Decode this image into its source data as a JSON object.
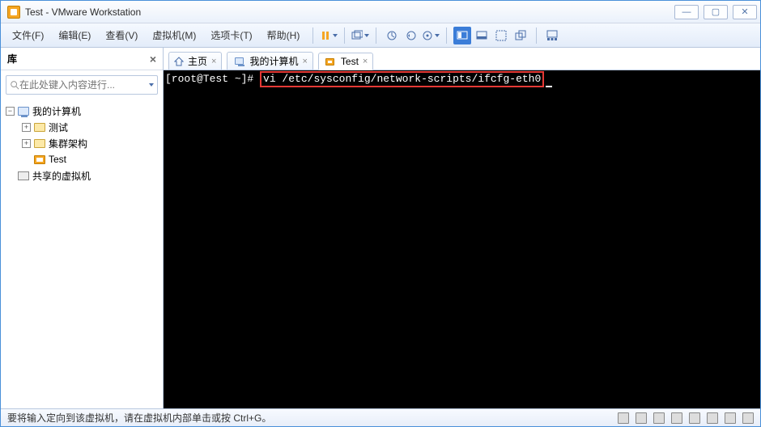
{
  "title": "Test - VMware Workstation",
  "menu": [
    "文件(F)",
    "编辑(E)",
    "查看(V)",
    "虚拟机(M)",
    "选项卡(T)",
    "帮助(H)"
  ],
  "sidebar": {
    "title": "库",
    "search_placeholder": "在此处键入内容进行...",
    "tree": {
      "root": "我的计算机",
      "folder1": "测试",
      "folder2": "集群架构",
      "vm": "Test",
      "shared": "共享的虚拟机"
    }
  },
  "tabs": {
    "home": "主页",
    "mycomputer": "我的计算机",
    "test": "Test"
  },
  "terminal": {
    "prompt": "[root@Test ~]# ",
    "command": "vi /etc/sysconfig/network-scripts/ifcfg-eth0"
  },
  "statusbar": "要将输入定向到该虚拟机，请在虚拟机内部单击或按 Ctrl+G。"
}
